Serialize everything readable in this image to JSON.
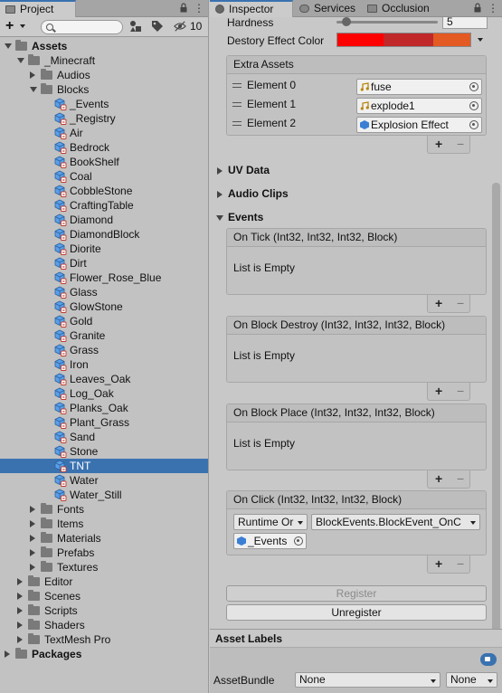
{
  "project": {
    "tab_label": "Project",
    "tab_icon": "folder-icon",
    "toolbar": {
      "add_label": "+",
      "search_placeholder": "",
      "hidden_count": "10"
    },
    "tree": [
      {
        "label": "Assets",
        "depth": 0,
        "expander": "open",
        "icon": "folder",
        "bold": true
      },
      {
        "label": "_Minecraft",
        "depth": 1,
        "expander": "open",
        "icon": "folder"
      },
      {
        "label": "Audios",
        "depth": 2,
        "expander": "closed",
        "icon": "folder"
      },
      {
        "label": "Blocks",
        "depth": 2,
        "expander": "open",
        "icon": "folder"
      },
      {
        "label": "_Events",
        "depth": 3,
        "icon": "prefab"
      },
      {
        "label": "_Registry",
        "depth": 3,
        "icon": "prefab"
      },
      {
        "label": "Air",
        "depth": 3,
        "icon": "prefab"
      },
      {
        "label": "Bedrock",
        "depth": 3,
        "icon": "prefab"
      },
      {
        "label": "BookShelf",
        "depth": 3,
        "icon": "prefab"
      },
      {
        "label": "Coal",
        "depth": 3,
        "icon": "prefab"
      },
      {
        "label": "CobbleStone",
        "depth": 3,
        "icon": "prefab"
      },
      {
        "label": "CraftingTable",
        "depth": 3,
        "icon": "prefab"
      },
      {
        "label": "Diamond",
        "depth": 3,
        "icon": "prefab"
      },
      {
        "label": "DiamondBlock",
        "depth": 3,
        "icon": "prefab"
      },
      {
        "label": "Diorite",
        "depth": 3,
        "icon": "prefab"
      },
      {
        "label": "Dirt",
        "depth": 3,
        "icon": "prefab"
      },
      {
        "label": "Flower_Rose_Blue",
        "depth": 3,
        "icon": "prefab"
      },
      {
        "label": "Glass",
        "depth": 3,
        "icon": "prefab"
      },
      {
        "label": "GlowStone",
        "depth": 3,
        "icon": "prefab"
      },
      {
        "label": "Gold",
        "depth": 3,
        "icon": "prefab"
      },
      {
        "label": "Granite",
        "depth": 3,
        "icon": "prefab"
      },
      {
        "label": "Grass",
        "depth": 3,
        "icon": "prefab"
      },
      {
        "label": "Iron",
        "depth": 3,
        "icon": "prefab"
      },
      {
        "label": "Leaves_Oak",
        "depth": 3,
        "icon": "prefab"
      },
      {
        "label": "Log_Oak",
        "depth": 3,
        "icon": "prefab"
      },
      {
        "label": "Planks_Oak",
        "depth": 3,
        "icon": "prefab"
      },
      {
        "label": "Plant_Grass",
        "depth": 3,
        "icon": "prefab"
      },
      {
        "label": "Sand",
        "depth": 3,
        "icon": "prefab"
      },
      {
        "label": "Stone",
        "depth": 3,
        "icon": "prefab"
      },
      {
        "label": "TNT",
        "depth": 3,
        "icon": "prefab",
        "selected": true
      },
      {
        "label": "Water",
        "depth": 3,
        "icon": "prefab"
      },
      {
        "label": "Water_Still",
        "depth": 3,
        "icon": "prefab"
      },
      {
        "label": "Fonts",
        "depth": 2,
        "expander": "closed",
        "icon": "folder"
      },
      {
        "label": "Items",
        "depth": 2,
        "expander": "closed",
        "icon": "folder"
      },
      {
        "label": "Materials",
        "depth": 2,
        "expander": "closed",
        "icon": "folder"
      },
      {
        "label": "Prefabs",
        "depth": 2,
        "expander": "closed",
        "icon": "folder"
      },
      {
        "label": "Textures",
        "depth": 2,
        "expander": "closed",
        "icon": "folder"
      },
      {
        "label": "Editor",
        "depth": 1,
        "expander": "closed",
        "icon": "folder"
      },
      {
        "label": "Scenes",
        "depth": 1,
        "expander": "closed",
        "icon": "folder"
      },
      {
        "label": "Scripts",
        "depth": 1,
        "expander": "closed",
        "icon": "folder"
      },
      {
        "label": "Shaders",
        "depth": 1,
        "expander": "closed",
        "icon": "folder"
      },
      {
        "label": "TextMesh Pro",
        "depth": 1,
        "expander": "closed",
        "icon": "folder"
      },
      {
        "label": "Packages",
        "depth": 0,
        "expander": "closed",
        "icon": "folder",
        "bold": true
      }
    ]
  },
  "inspector": {
    "tabs": [
      {
        "label": "Inspector",
        "icon": "info-icon",
        "active": true
      },
      {
        "label": "Services",
        "icon": "cloud-icon"
      },
      {
        "label": "Occlusion",
        "icon": "occlusion-icon"
      }
    ],
    "hardness": {
      "label": "Hardness",
      "value": "5",
      "fraction": 0.1
    },
    "destroy_color": {
      "label": "Destory Effect Color",
      "swatches": [
        "#ff0000",
        "#c0282a",
        "#e35a22"
      ]
    },
    "extra_assets": {
      "title": "Extra Assets",
      "elements": [
        {
          "label": "Element 0",
          "value": "fuse",
          "icon": "audio-clip-icon"
        },
        {
          "label": "Element 1",
          "value": "explode1",
          "icon": "audio-clip-icon"
        },
        {
          "label": "Element 2",
          "value": "Explosion Effect",
          "icon": "prefab-icon"
        }
      ]
    },
    "foldouts": {
      "uv_data": "UV Data",
      "audio_clips": "Audio Clips",
      "events": "Events"
    },
    "events": [
      {
        "title": "On Tick (Int32, Int32, Int32, Block)",
        "empty_text": "List is Empty"
      },
      {
        "title": "On Block Destroy (Int32, Int32, Int32, Block)",
        "empty_text": "List is Empty"
      },
      {
        "title": "On Block Place (Int32, Int32, Int32, Block)",
        "empty_text": "List is Empty"
      }
    ],
    "on_click": {
      "title": "On Click (Int32, Int32, Int32, Block)",
      "runtime": "Runtime Or",
      "method": "BlockEvents.BlockEvent_OnC",
      "target": "_Events"
    },
    "buttons": {
      "register": "Register",
      "unregister": "Unregister"
    },
    "asset_labels": {
      "title": "Asset Labels",
      "bundle_label": "AssetBundle",
      "bundle_value": "None",
      "variant_value": "None"
    },
    "colors": {
      "accent": "#3a72b0"
    }
  }
}
